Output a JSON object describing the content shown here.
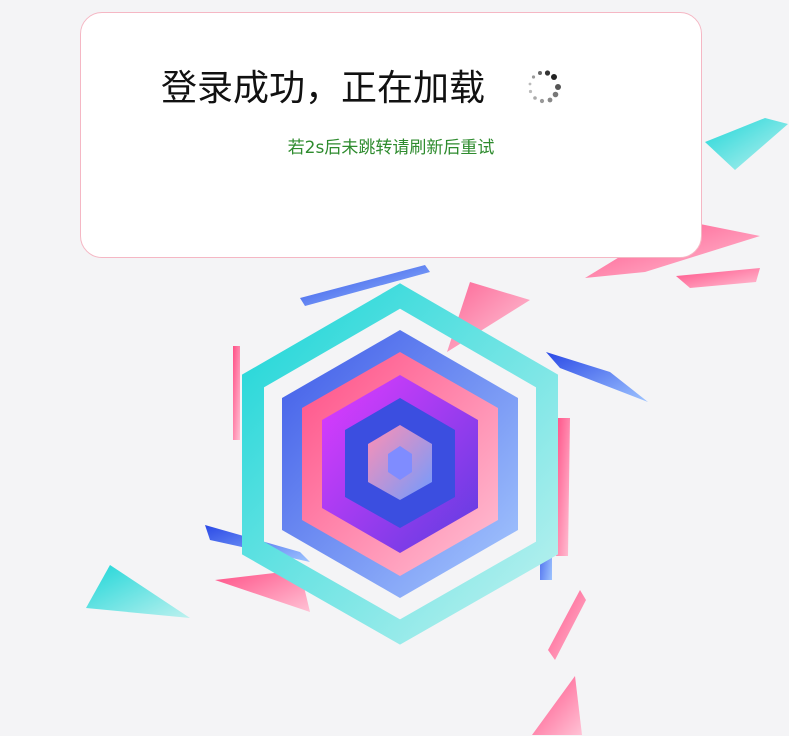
{
  "dialog": {
    "title": "登录成功，正在加载",
    "hint": "若2s后未跳转请刷新后重试"
  },
  "spinner": {
    "icon": "loading-spinner-icon"
  },
  "colors": {
    "dialog_border": "#f5b7c4",
    "hint_text": "#2e8b2e",
    "background": "#f4f4f6"
  }
}
